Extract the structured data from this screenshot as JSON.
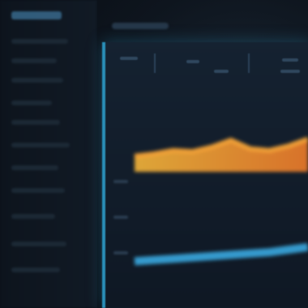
{
  "colors": {
    "background": "#0b1018",
    "accent": "#2a8fb8",
    "series_orange": "#f39a2f",
    "series_blue": "#3aa8e0"
  },
  "sidebar": {
    "nav_items": [
      "",
      "",
      "",
      "",
      "",
      "",
      "",
      "",
      "",
      "",
      ""
    ]
  },
  "main": {
    "title": ""
  },
  "chart": {
    "orange_series": [
      0.42,
      0.46,
      0.52,
      0.5,
      0.58,
      0.7,
      0.55,
      0.52,
      0.6,
      0.72
    ],
    "blue_series": [
      0.12,
      0.14,
      0.16,
      0.18,
      0.2,
      0.22,
      0.24,
      0.26,
      0.3,
      0.34
    ]
  }
}
